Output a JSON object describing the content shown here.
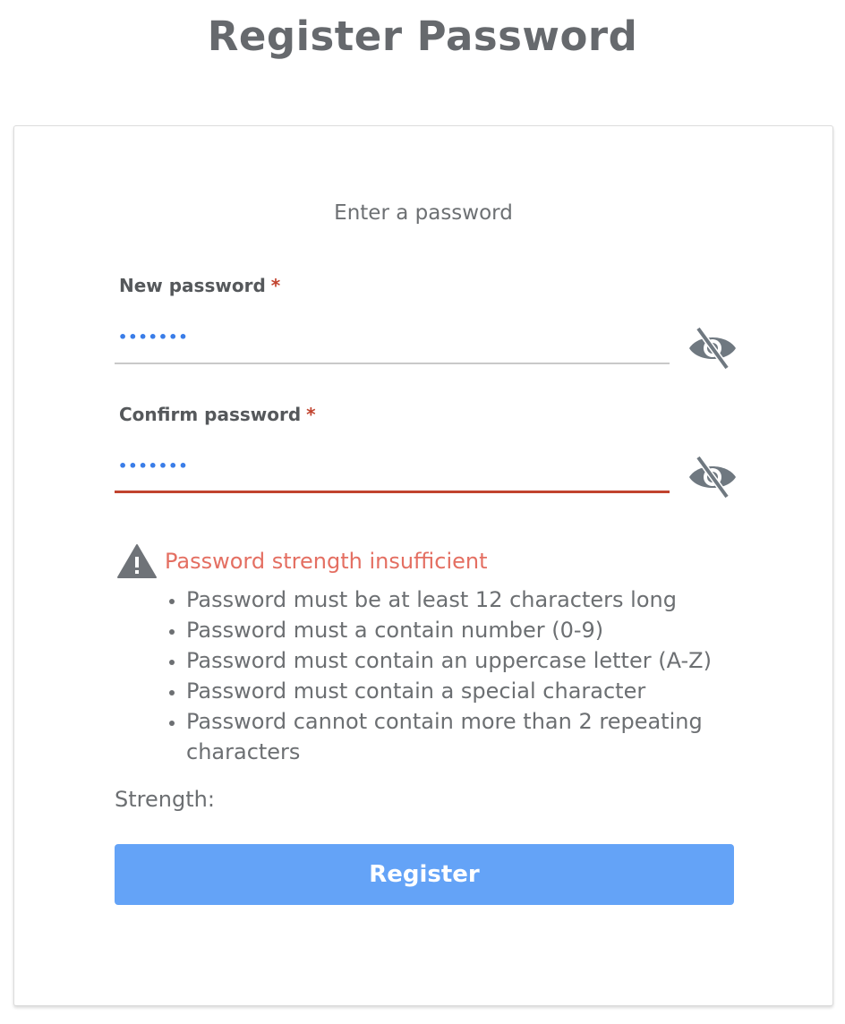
{
  "page": {
    "title": "Register Password"
  },
  "form": {
    "subtitle": "Enter a password",
    "required_marker": "*",
    "new_password": {
      "label": "New password",
      "value_masked": "•••••••"
    },
    "confirm_password": {
      "label": "Confirm password",
      "value_masked": "•••••••"
    },
    "toggle_icon": "eye-slash-icon"
  },
  "validation": {
    "icon": "warning-icon",
    "message": "Password strength insufficient",
    "requirements": [
      "Password must be at least 12 characters long",
      "Password must a contain number (0-9)",
      "Password must contain an uppercase letter (A-Z)",
      "Password must contain a special character",
      "Password cannot contain more than 2 repeating characters"
    ]
  },
  "strength": {
    "label": "Strength:"
  },
  "actions": {
    "register_label": "Register"
  },
  "colors": {
    "accent": "#64a3f7",
    "error": "#c1432e",
    "warning_text": "#e46f62",
    "input_text": "#3a7de8"
  }
}
